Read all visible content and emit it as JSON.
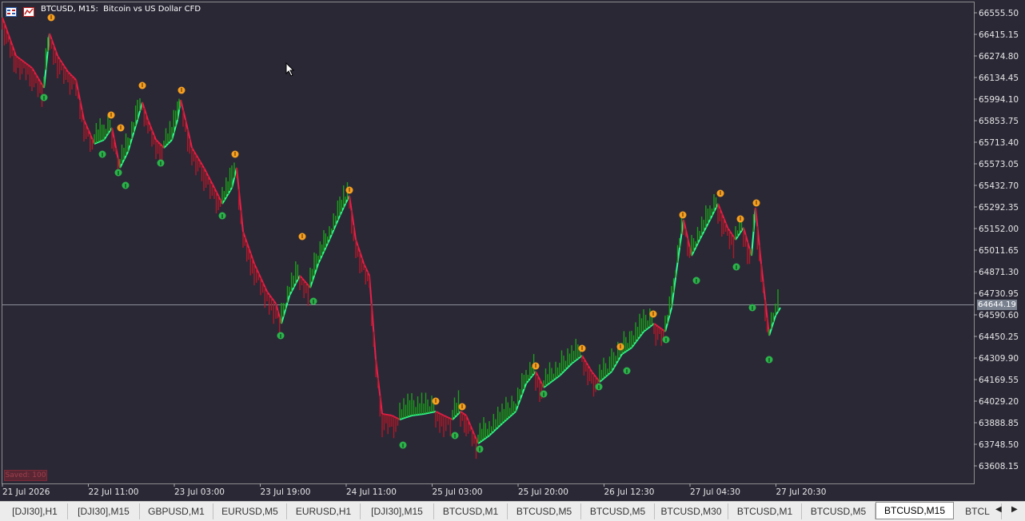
{
  "chart": {
    "title": "BTCUSD, M15:  Bitcoin vs US Dollar CFD",
    "current_price": "64644.19",
    "watermark": "Saved: 100",
    "price_labels": [
      "66555.50",
      "66415.15",
      "66274.80",
      "66134.45",
      "65994.10",
      "65853.75",
      "65713.40",
      "65573.05",
      "65432.70",
      "65292.35",
      "65152.00",
      "65011.65",
      "64871.30",
      "64730.95",
      "64590.60",
      "64450.25",
      "64309.90",
      "64169.55",
      "64029.20",
      "63888.85",
      "63748.50",
      "63608.15"
    ],
    "time_labels": [
      "21 Jul 2026",
      "22 Jul 11:00",
      "23 Jul 03:00",
      "23 Jul 19:00",
      "24 Jul 11:00",
      "25 Jul 03:00",
      "25 Jul 20:00",
      "26 Jul 12:30",
      "27 Jul 04:30",
      "27 Jul 20:30"
    ],
    "colors": {
      "background": "#2b2836",
      "bull": "#18a018",
      "bear": "#b01828",
      "line_up": "#33ff99",
      "line_down": "#e8204a",
      "arrow_sell": "#f5a020",
      "arrow_buy": "#2bb34a",
      "axis_text": "#e6e6e6"
    }
  },
  "tabs": [
    {
      "label": "[DJI30],H1"
    },
    {
      "label": "[DJI30],M15"
    },
    {
      "label": "GBPUSD,M1"
    },
    {
      "label": "EURUSD,M5"
    },
    {
      "label": "EURUSD,H1"
    },
    {
      "label": "[DJI30],M15"
    },
    {
      "label": "BTCUSD,M1"
    },
    {
      "label": "BTCUSD,M5"
    },
    {
      "label": "BTCUSD,M5"
    },
    {
      "label": "BTCUSD,M30"
    },
    {
      "label": "BTCUSD,M1"
    },
    {
      "label": "BTCUSD,M5"
    },
    {
      "label": "BTCUSD,M15",
      "active": true
    },
    {
      "label": "BTCL"
    }
  ],
  "tab_scroll": {
    "left": "◀",
    "right": "▶"
  }
}
